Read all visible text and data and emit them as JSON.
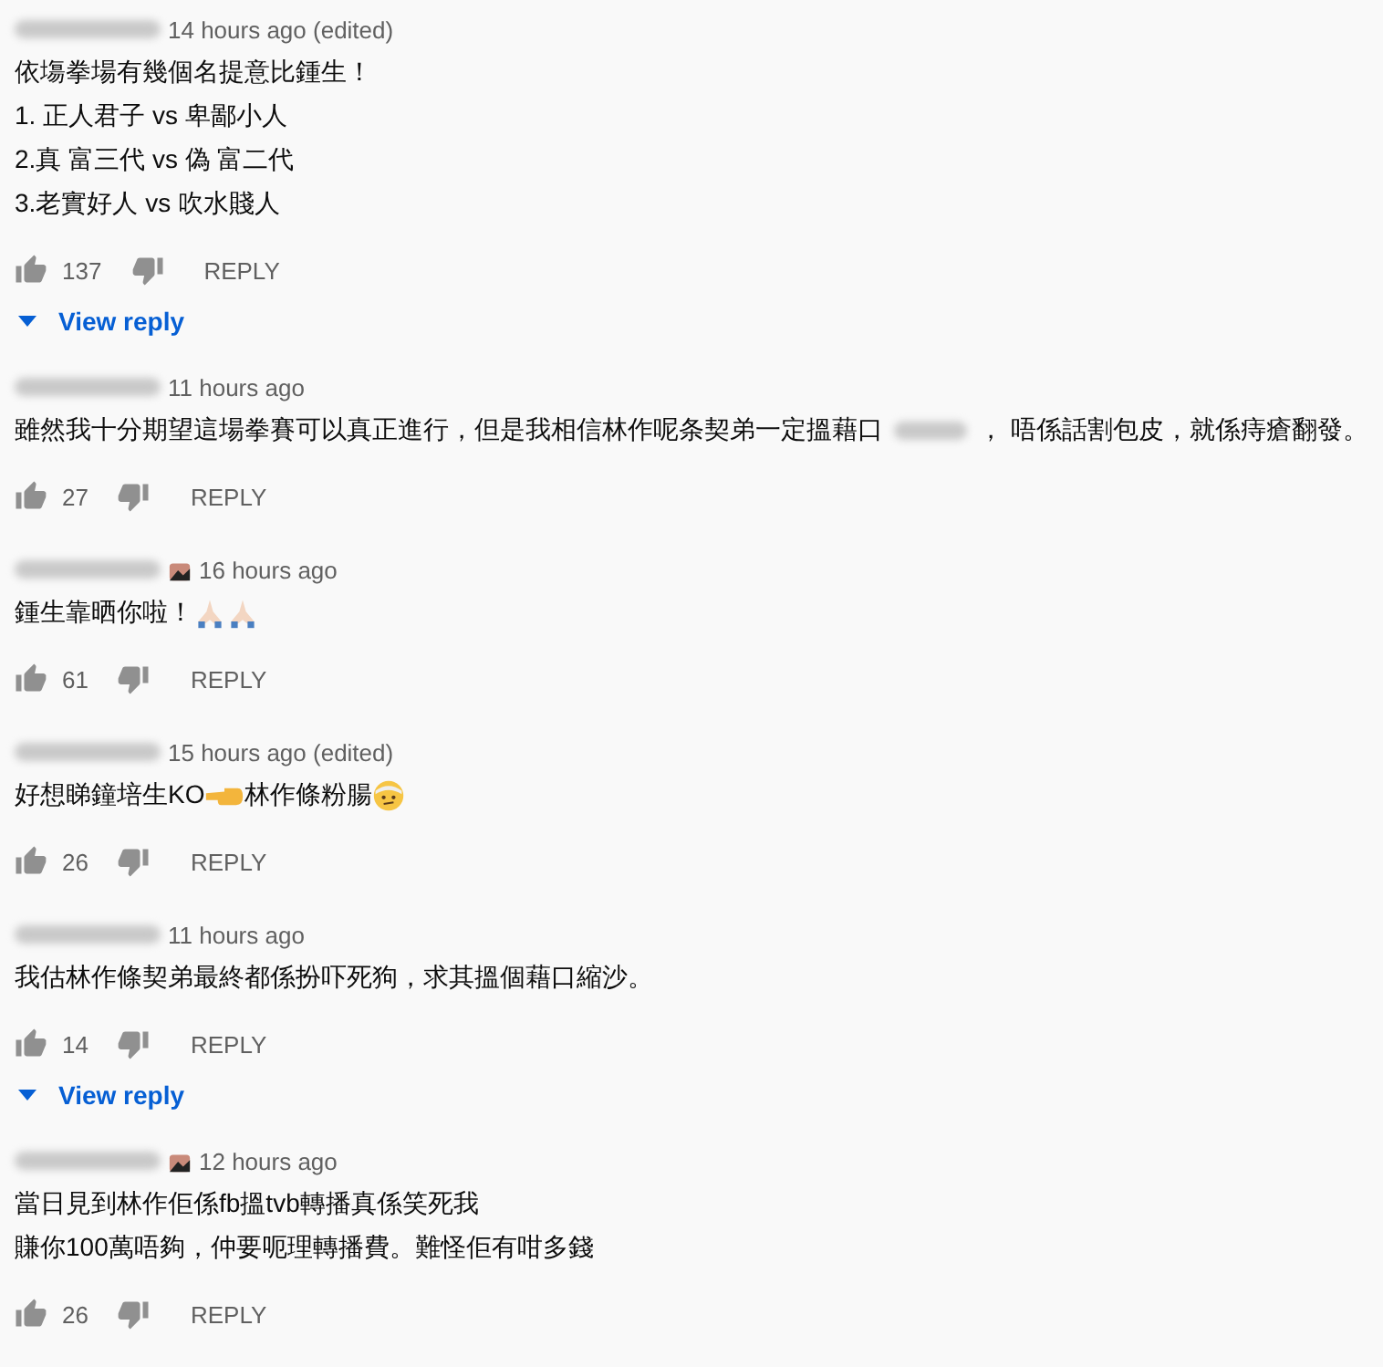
{
  "comments": [
    {
      "badge": false,
      "time": "14 hours ago (edited)",
      "lines": [
        [
          {
            "kind": "text",
            "text": "依塲拳場有幾個名提意比鍾生！"
          }
        ],
        [
          {
            "kind": "text",
            "text": "1. 正人君子 vs 卑鄙小人"
          }
        ],
        [
          {
            "kind": "text",
            "text": "2.真 富三代  vs 偽 富二代"
          }
        ],
        [
          {
            "kind": "text",
            "text": "3.老實好人 vs 吹水賤人"
          }
        ]
      ],
      "likes": "137",
      "reply": "REPLY",
      "view_reply": "View reply"
    },
    {
      "badge": false,
      "time": "11 hours ago",
      "lines": [
        [
          {
            "kind": "text",
            "text": "雖然我十分期望這場拳賽可以真正進行，但是我相信林作呢条契弟一定搵藉口"
          },
          {
            "kind": "redacted"
          },
          {
            "kind": "text",
            "text": "， 唔係話割包皮，就係痔瘡翻發。"
          }
        ]
      ],
      "likes": "27",
      "reply": "REPLY"
    },
    {
      "badge": true,
      "time": "16 hours ago",
      "lines": [
        [
          {
            "kind": "text",
            "text": "鍾生靠晒你啦！"
          },
          {
            "kind": "hands"
          },
          {
            "kind": "hands"
          }
        ]
      ],
      "likes": "61",
      "reply": "REPLY"
    },
    {
      "badge": false,
      "time": "15 hours ago (edited)",
      "lines": [
        [
          {
            "kind": "text",
            "text": "好想睇鐘培生KO"
          },
          {
            "kind": "fist"
          },
          {
            "kind": "text",
            "text": "林作條粉腸"
          },
          {
            "kind": "face"
          }
        ]
      ],
      "likes": "26",
      "reply": "REPLY"
    },
    {
      "badge": false,
      "time": "11 hours ago",
      "lines": [
        [
          {
            "kind": "text",
            "text": "我估林作條契弟最終都係扮吓死狗，求其搵個藉口縮沙。"
          }
        ]
      ],
      "likes": "14",
      "reply": "REPLY",
      "view_reply": "View reply"
    },
    {
      "badge": true,
      "time": "12 hours ago",
      "lines": [
        [
          {
            "kind": "text",
            "text": "當日見到林作佢係fb搵tvb轉播真係笑死我"
          }
        ],
        [
          {
            "kind": "text",
            "text": "賺你100萬唔夠，仲要呃理轉播費。難怪佢有咁多錢"
          }
        ]
      ],
      "likes": "26",
      "reply": "REPLY"
    }
  ]
}
